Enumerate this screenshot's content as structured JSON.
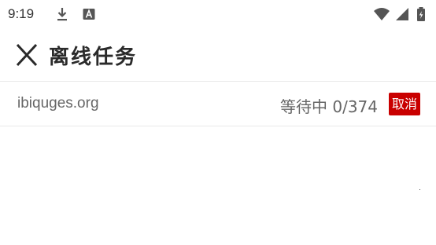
{
  "status_bar": {
    "time": "9:19",
    "icons": [
      "download-icon",
      "a-icon",
      "wifi-icon",
      "signal-icon",
      "battery-charging-icon"
    ]
  },
  "header": {
    "close_icon": "close-icon",
    "title": "离线任务"
  },
  "tasks": [
    {
      "site": "ibiquges.org",
      "status": "等待中",
      "progress": "0/374",
      "progress_done": 0,
      "progress_total": 374,
      "cancel_label": "取消"
    }
  ],
  "colors": {
    "background": "#ffffff",
    "title_text": "#2a2a2a",
    "secondary_text": "#666666",
    "cancel_button": "#c90000",
    "divider": "#e8e8e8"
  }
}
